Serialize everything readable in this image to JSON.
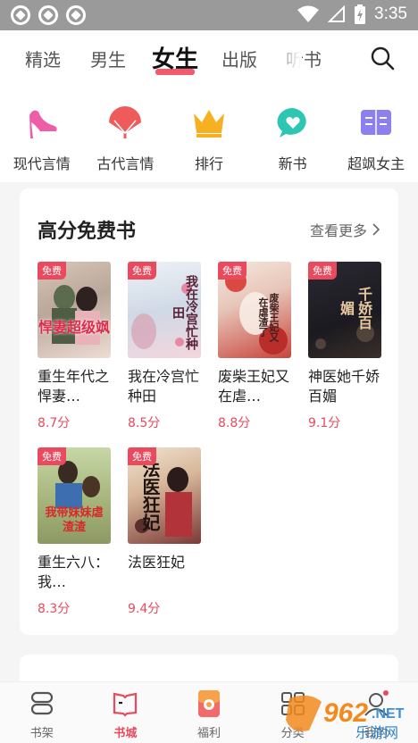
{
  "status_bar": {
    "time": "3:35"
  },
  "top_tabs": [
    "精选",
    "男生",
    "女生",
    "出版",
    "听书"
  ],
  "active_tab": "女生",
  "categories": [
    {
      "label": "现代言情",
      "icon": "high-heel-icon"
    },
    {
      "label": "古代言情",
      "icon": "fan-icon"
    },
    {
      "label": "排行",
      "icon": "crown-icon"
    },
    {
      "label": "新书",
      "icon": "heart-bubble-icon"
    },
    {
      "label": "超飒女主",
      "icon": "book-icon"
    }
  ],
  "section": {
    "title": "高分免费书",
    "more_label": "查看更多",
    "books": [
      {
        "name": "重生年代之悍妻…",
        "score": "8.7分",
        "badge": "免费",
        "cover_text": "悍妻超级飒"
      },
      {
        "name": "我在冷宫忙种田",
        "score": "8.5分",
        "badge": "免费",
        "cover_text": "我在冷宫忙种田"
      },
      {
        "name": "废柴王妃又在虐…",
        "score": "8.8分",
        "badge": "免费",
        "cover_text": "废柴王妃又在虐渣了"
      },
      {
        "name": "神医她千娇百媚",
        "score": "9.1分",
        "badge": "免费",
        "cover_text": "千娇百媚"
      },
      {
        "name": "重生六八：我…",
        "score": "8.3分",
        "badge": "免费",
        "cover_text": "我带妹妹虐渣渣"
      },
      {
        "name": "法医狂妃",
        "score": "9.4分",
        "badge": "免费",
        "cover_text": "法医狂妃"
      }
    ]
  },
  "bottom_nav": [
    {
      "label": "书架",
      "icon": "bookshelf-icon"
    },
    {
      "label": "书城",
      "icon": "bookstore-icon"
    },
    {
      "label": "福利",
      "icon": "gift-icon"
    },
    {
      "label": "分类",
      "icon": "grid-icon"
    },
    {
      "label": "我的",
      "icon": "profile-icon"
    }
  ],
  "active_bottom": "书城",
  "watermark": {
    "text": "962",
    "sub": "乐游网",
    "domain": ".NET"
  },
  "colors": {
    "accent": "#e94a5e",
    "status_bar": "#9a9a9a"
  }
}
